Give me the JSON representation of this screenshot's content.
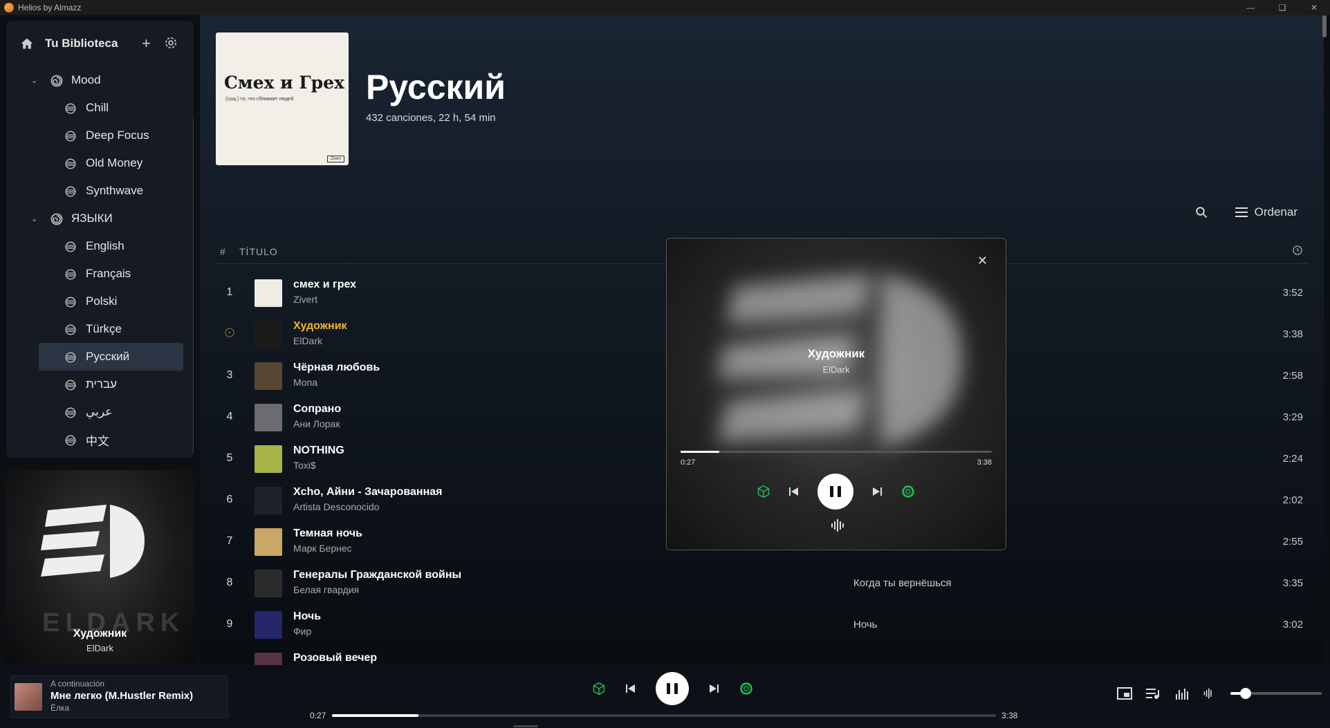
{
  "window": {
    "title": "Helios by Almazz"
  },
  "sidebar": {
    "library_label": "Tu Biblioteca",
    "groups": [
      {
        "label": "Mood",
        "items": [
          "Chill",
          "Deep Focus",
          "Old Money",
          "Synthwave"
        ]
      },
      {
        "label": "ЯЗЫКИ",
        "items": [
          "English",
          "Français",
          "Polski",
          "Türkçe",
          "Русский",
          "עברית",
          "عربي",
          "中文"
        ]
      }
    ],
    "active_item": "Русский"
  },
  "now_playing_art": {
    "title": "Художник",
    "artist": "ElDark",
    "watermark": "ELDARK"
  },
  "playlist": {
    "cover_title": "Смех и Грех",
    "cover_subtitle": "(сущ.) то, что сближает людей",
    "cover_badge": "Zivert",
    "title": "Русский",
    "meta": "432 canciones, 22 h, 54 min",
    "sort_label": "Ordenar",
    "col_hash": "#",
    "col_title": "TÍTULO",
    "tracks": [
      {
        "n": "1",
        "title": "смех и грех",
        "artist": "Zivert",
        "album": "",
        "duration": "3:52",
        "thumb": "#efece5"
      },
      {
        "n": "",
        "title": "Художник",
        "artist": "ElDark",
        "album": "",
        "duration": "3:38",
        "thumb": "#1b1b1b",
        "playing": true
      },
      {
        "n": "3",
        "title": "Чёрная любовь",
        "artist": "Mona",
        "album": "",
        "duration": "2:58",
        "thumb": "#5a4634"
      },
      {
        "n": "4",
        "title": "Сопрано",
        "artist": "Ани Лорак",
        "album": "",
        "duration": "3:29",
        "thumb": "#6b6b70"
      },
      {
        "n": "5",
        "title": "NOTHING",
        "artist": "Toxi$",
        "album": "",
        "duration": "2:24",
        "thumb": "#a6b446"
      },
      {
        "n": "6",
        "title": "Xcho, Айни - Зачарованная",
        "artist": "Artista Desconocido",
        "album": "",
        "duration": "2:02",
        "thumb": "#1e232b"
      },
      {
        "n": "7",
        "title": "Темная ночь",
        "artist": "Марк Бернес",
        "album": "",
        "duration": "2:55",
        "thumb": "#c9a765"
      },
      {
        "n": "8",
        "title": "Генералы Гражданской войны",
        "artist": "Белая гвардия",
        "album": "Когда ты вернёшься",
        "duration": "3:35",
        "thumb": "#2b2b2b"
      },
      {
        "n": "9",
        "title": "Ночь",
        "artist": "Фир",
        "album": "Ночь",
        "duration": "3:02",
        "thumb": "#25256a"
      },
      {
        "n": "",
        "title": "Розовый вечер",
        "artist": "",
        "album": "",
        "duration": "",
        "thumb": "#553344"
      }
    ]
  },
  "mini_player": {
    "title": "Художник",
    "artist": "ElDark",
    "elapsed": "0:27",
    "total": "3:38",
    "progress": 0.124
  },
  "player": {
    "next_label": "A continuación",
    "next_title": "Мне легко (M.Hustler Remix)",
    "next_artist": "Ёлка",
    "elapsed": "0:27",
    "total": "3:38",
    "progress": 0.13,
    "volume": 0.17
  },
  "colors": {
    "accent": "#f2b824",
    "green": "#1db954"
  }
}
